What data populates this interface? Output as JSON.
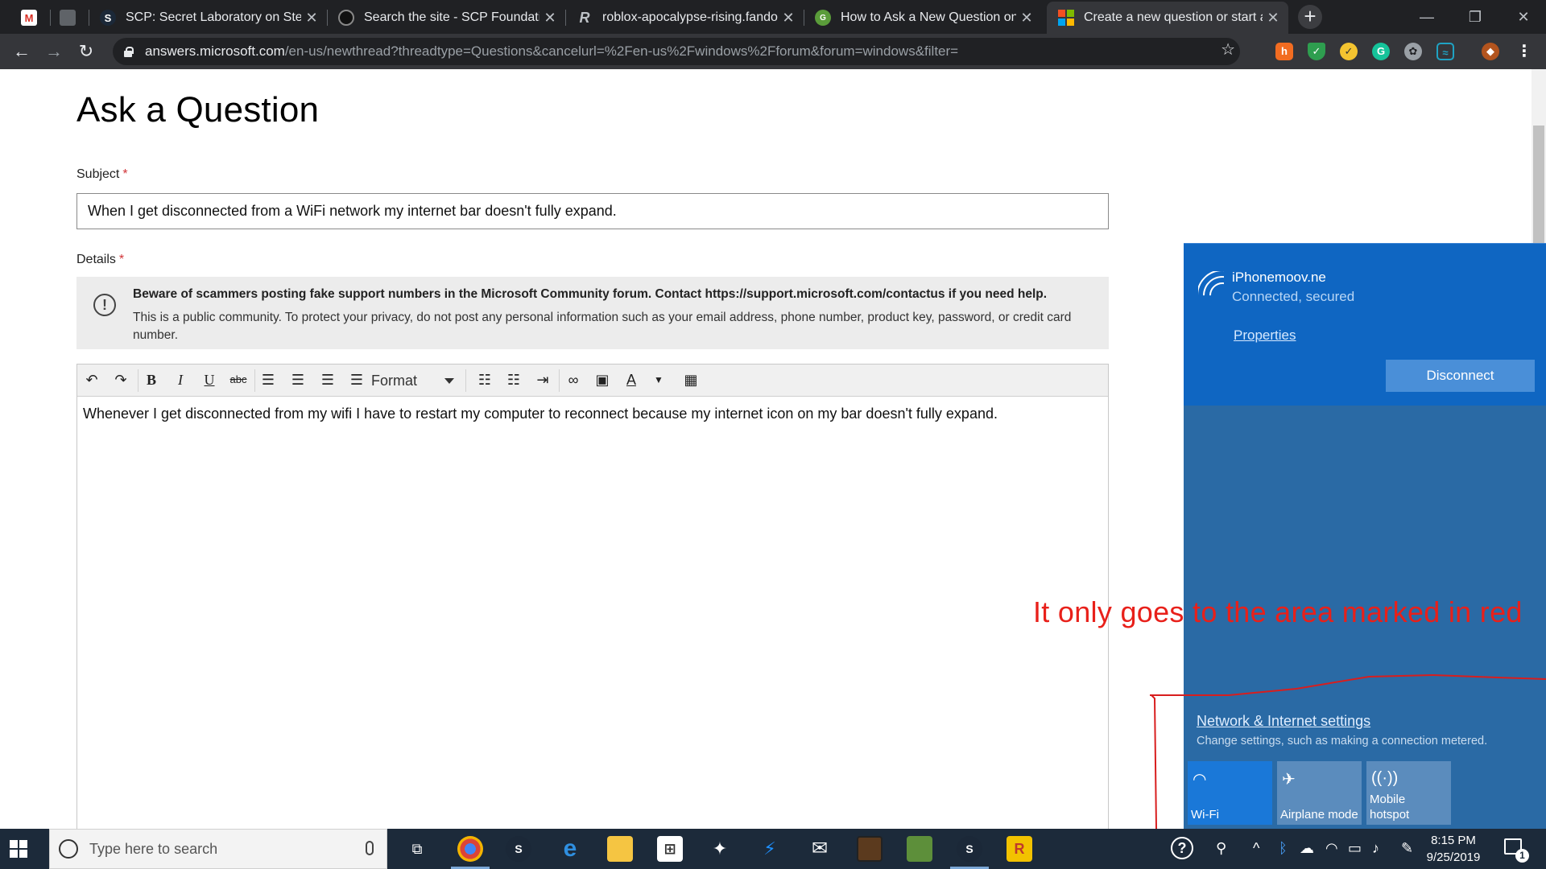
{
  "browser": {
    "tabs": [
      {
        "title": "",
        "favicon": "gmail-icon"
      },
      {
        "title": "",
        "favicon": "blank-tab-icon"
      },
      {
        "title": "SCP: Secret Laboratory on Steam",
        "favicon": "steam-icon"
      },
      {
        "title": "Search the site - SCP Foundation",
        "favicon": "scp-icon"
      },
      {
        "title": "roblox-apocalypse-rising.fandom",
        "favicon": "fandom-icon"
      },
      {
        "title": "How to Ask a New Question on M",
        "favicon": "msa-icon"
      },
      {
        "title": "Create a new question or start a",
        "favicon": "microsoft-icon"
      }
    ],
    "active_tab_index": 6,
    "url_host": "answers.microsoft.com",
    "url_path": "/en-us/newthread?threadtype=Questions&cancelurl=%2Fen-us%2Fwindows%2Fforum&forum=windows&filter=",
    "extensions": [
      "honey-icon",
      "shield-icon",
      "norton-icon",
      "grammarly-icon",
      "chrome-ext-icon",
      "vpn-icon",
      "avatar-icon"
    ]
  },
  "page": {
    "title": "Ask a Question",
    "subject_label": "Subject",
    "required_mark": "*",
    "subject_value": "When I get disconnected from a WiFi network my internet bar doesn't fully expand.",
    "details_label": "Details",
    "notice_bold": "Beware of scammers posting fake support numbers in the Microsoft Community forum. Contact https://support.microsoft.com/contactus if you need help.",
    "notice_text": "This is a public community. To protect your privacy, do not post any personal information such as your email address, phone number, product key, password, or credit card number.",
    "editor": {
      "format_label": "Format",
      "body": "Whenever I get disconnected from my wifi I have to restart my computer to reconnect because my internet icon on my bar doesn't fully expand."
    }
  },
  "annotation": {
    "text": "It only goes to the area marked in red",
    "color": "#e8201a"
  },
  "network_flyout": {
    "network_name": "iPhonemoov.ne",
    "status": "Connected, secured",
    "properties_label": "Properties",
    "disconnect_label": "Disconnect",
    "settings_link": "Network & Internet settings",
    "settings_desc": "Change settings, such as making a connection metered.",
    "quick_actions": [
      {
        "label": "Wi-Fi",
        "active": true
      },
      {
        "label": "Airplane mode",
        "active": false
      },
      {
        "label": "Mobile hotspot",
        "active": false
      }
    ]
  },
  "taskbar": {
    "search_placeholder": "Type here to search",
    "time": "8:15 PM",
    "date": "9/25/2019",
    "notification_count": "1"
  }
}
